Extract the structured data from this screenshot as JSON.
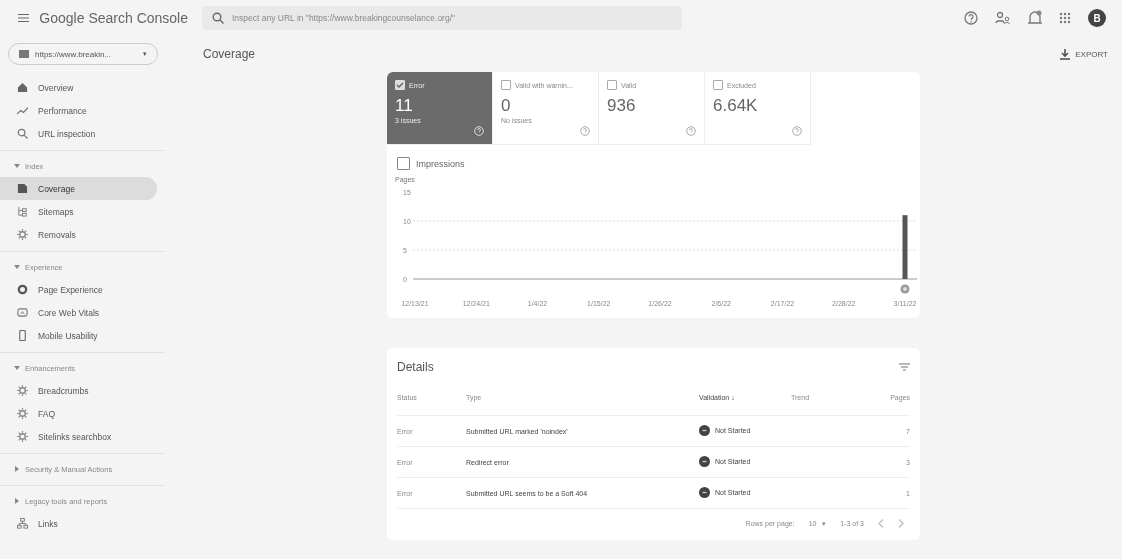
{
  "app_bar": {
    "title": "Google Search Console",
    "search": {
      "placeholder": "Inspect any URL in \"https://www.breakingcounselance.org/\""
    },
    "avatar": "B"
  },
  "property": {
    "label": "https://www.breakin...",
    "caret": "▾"
  },
  "page_title": "Coverage",
  "export": "EXPORT",
  "sidebar": {
    "items": [
      {
        "kind": "item",
        "label": "Overview",
        "selected": false
      },
      {
        "kind": "item",
        "label": "Performance",
        "selected": false
      },
      {
        "kind": "item",
        "label": "URL inspection",
        "selected": false
      },
      {
        "kind": "section",
        "label": "Index",
        "expanded": true,
        "children": [
          {
            "kind": "item",
            "label": "Coverage",
            "selected": true
          },
          {
            "kind": "item",
            "label": "Sitemaps",
            "selected": false
          },
          {
            "kind": "item",
            "label": "Removals",
            "selected": false
          }
        ]
      },
      {
        "kind": "section",
        "label": "Experience",
        "expanded": true,
        "children": [
          {
            "kind": "item",
            "label": "Page Experience",
            "selected": false
          },
          {
            "kind": "item",
            "label": "Core Web Vitals",
            "selected": false
          },
          {
            "kind": "item",
            "label": "Mobile Usability",
            "selected": false
          }
        ]
      },
      {
        "kind": "section",
        "label": "Enhancements",
        "expanded": true,
        "children": [
          {
            "kind": "item",
            "label": "Breadcrumbs",
            "selected": false
          },
          {
            "kind": "item",
            "label": "FAQ",
            "selected": false
          },
          {
            "kind": "item",
            "label": "Sitelinks searchbox",
            "selected": false
          }
        ]
      },
      {
        "kind": "section",
        "label": "Security & Manual Actions",
        "expanded": false
      },
      {
        "kind": "section",
        "label": "Legacy tools and reports",
        "expanded": false
      },
      {
        "kind": "item",
        "label": "Links",
        "selected": false
      }
    ]
  },
  "cards": [
    {
      "label": "Error",
      "value": "11",
      "sub": "3 issues",
      "selected": true
    },
    {
      "label": "Valid with warnin...",
      "value": "0",
      "sub": "No issues",
      "selected": false
    },
    {
      "label": "Valid",
      "value": "936",
      "selected": false
    },
    {
      "label": "Excluded",
      "value": "6.64K",
      "selected": false
    }
  ],
  "impressions": {
    "label": "Impressions",
    "checked": false
  },
  "chart": {
    "chart_data": {
      "type": "bar",
      "ylabel": "Pages",
      "categories": [
        "12/13/21",
        "12/24/21",
        "1/4/22",
        "1/15/22",
        "1/26/22",
        "2/6/22",
        "2/17/22",
        "2/28/22",
        "3/11/22"
      ],
      "values": [
        null,
        null,
        null,
        null,
        null,
        null,
        null,
        null,
        11
      ],
      "ylim": [
        0,
        15
      ],
      "yticks": [
        0,
        5,
        10,
        15
      ]
    }
  },
  "details": {
    "title": "Details",
    "columns": [
      "Status",
      "Type",
      "Validation",
      "Trend",
      "Pages"
    ],
    "sort_arrow": "↓",
    "rows": [
      {
        "status": "Error",
        "type": "Submitted URL marked 'noindex'",
        "validation": "Not Started",
        "pages": "7"
      },
      {
        "status": "Error",
        "type": "Redirect error",
        "validation": "Not Started",
        "pages": "3"
      },
      {
        "status": "Error",
        "type": "Submitted URL seems to be a Soft 404",
        "validation": "Not Started",
        "pages": "1"
      }
    ],
    "pagination": {
      "label": "Rows per page:",
      "per_page": "10",
      "caret": "▾",
      "range": "1-3 of 3"
    }
  }
}
